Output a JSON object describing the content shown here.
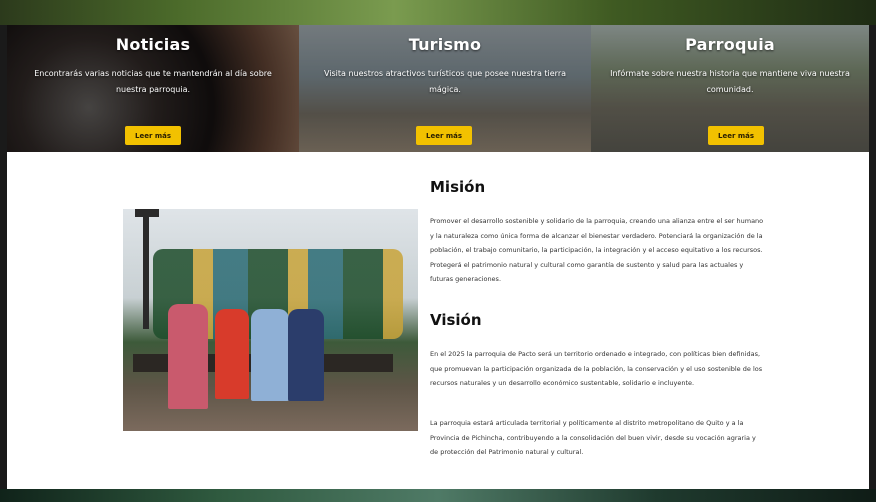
{
  "hero": {
    "cards": [
      {
        "title": "Noticias",
        "text": "Encontrarás varias noticias que te mantendrán al día sobre nuestra parroquia.",
        "button": "Leer más"
      },
      {
        "title": "Turismo",
        "text": "Visita nuestros atractivos turísticos que posee nuestra tierra mágica.",
        "button": "Leer más"
      },
      {
        "title": "Parroquia",
        "text": "Infórmate sobre nuestra historia que mantiene viva nuestra comunidad.",
        "button": "Leer más"
      }
    ]
  },
  "about": {
    "mision_title": "Misión",
    "mision_text": "Promover el desarrollo sostenible y solidario de la parroquia, creando una alianza entre el ser humano y la naturaleza como única forma de alcanzar el bienestar verdadero. Potenciará la organización de la población, el trabajo comunitario, la participación, la integración y el acceso equitativo a los recursos. Protegerá el patrimonio natural y cultural como garantía de sustento y salud para las actuales y futuras generaciones.",
    "vision_title": "Visión",
    "vision_text_1": "En el 2025 la parroquia de Pacto será un territorio ordenado e integrado, con políticas bien definidas, que promuevan la participación organizada de la población, la conservación y el uso sostenible de los recursos naturales y un desarrollo económico sustentable, solidario e incluyente.",
    "vision_text_2": "La parroquia estará articulada territorial y políticamente al distrito metropolitano de Quito y a la Provincia de Pichincha, contribuyendo a la consolidación del buen vivir, desde su vocación agraria y de protección del Patrimonio natural y cultural."
  },
  "colors": {
    "button_bg": "#f2c100",
    "heading": "#111111",
    "body_text": "#333333"
  }
}
